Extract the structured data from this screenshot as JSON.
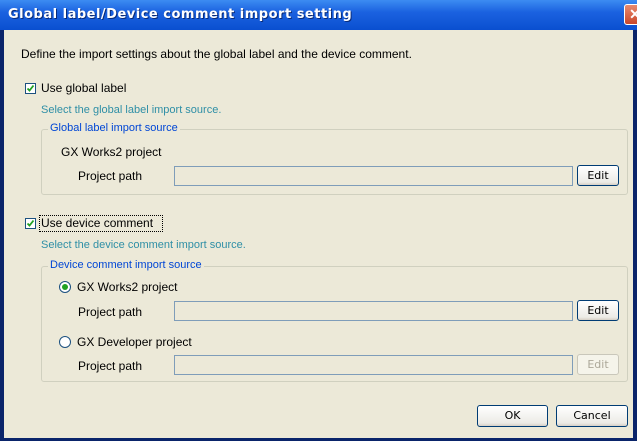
{
  "window": {
    "title": "Global label/Device comment import setting",
    "close_glyph": "✕"
  },
  "description": "Define the import settings about the global label and the device comment.",
  "global_label": {
    "checkbox_label": "Use global label",
    "checked": true,
    "hint": "Select the global label import source.",
    "group_title": "Global label import source",
    "source_name": "GX Works2 project",
    "path_label": "Project path",
    "path_value": "",
    "edit_label": "Edit"
  },
  "device_comment": {
    "checkbox_label": "Use device comment",
    "checked": true,
    "hint": "Select the device comment import source.",
    "group_title": "Device comment import source",
    "options": [
      {
        "label": "GX Works2 project",
        "selected": true,
        "path_label": "Project path",
        "path_value": "",
        "edit_label": "Edit",
        "edit_enabled": true
      },
      {
        "label": "GX Developer project",
        "selected": false,
        "path_label": "Project path",
        "path_value": "",
        "edit_label": "Edit",
        "edit_enabled": false
      }
    ]
  },
  "footer": {
    "ok_label": "OK",
    "cancel_label": "Cancel"
  },
  "colors": {
    "title_bar": "#1b62e0",
    "hint_text": "#2f8fa6",
    "group_title": "#0046d5",
    "dialog_bg": "#ece9d8"
  }
}
